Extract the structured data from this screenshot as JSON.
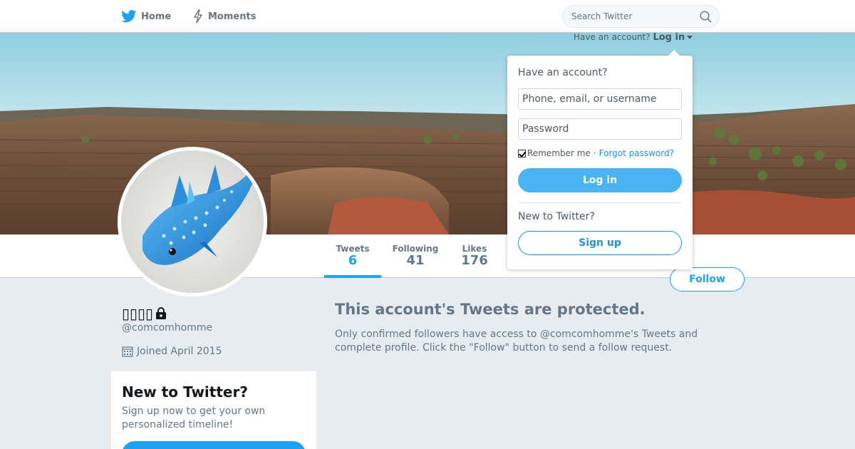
{
  "nav": {
    "home_label": "Home",
    "moments_label": "Moments",
    "search_placeholder": "Search Twitter",
    "icons": {
      "home": "twitter-bird-icon",
      "moments": "lightning-icon",
      "search": "search-icon"
    }
  },
  "login_toggle": {
    "prompt": "Have an account?",
    "action": "Log in"
  },
  "login_dropdown": {
    "heading": "Have an account?",
    "username_placeholder": "Phone, email, or username",
    "password_placeholder": "Password",
    "remember_label": "Remember me",
    "separator": "·",
    "forgot_label": "Forgot password?",
    "login_button": "Log in",
    "new_heading": "New to Twitter?",
    "signup_button": "Sign up"
  },
  "profile_nav": {
    "stats": [
      {
        "label": "Tweets",
        "value": "6"
      },
      {
        "label": "Following",
        "value": "41"
      },
      {
        "label": "Likes",
        "value": "176"
      }
    ],
    "follow_button": "Follow"
  },
  "profile": {
    "name": "▯▯▯▯",
    "handle": "@comcomhomme",
    "joined": "Joined April 2015",
    "icons": {
      "name_suffix": "lock-icon",
      "joined": "calendar-icon"
    }
  },
  "signup_card": {
    "title": "New to Twitter?",
    "body": "Sign up now to get your own personalized timeline!"
  },
  "protected": {
    "title": "This account's Tweets are protected.",
    "body": "Only confirmed followers have access to @comcomhomme's Tweets and complete profile. Click the \"Follow\" button to send a follow request."
  },
  "colors": {
    "accent": "#1da1f2",
    "link": "#1b95e0",
    "muted_text": "#657786",
    "page_bg": "#e6ecf0"
  }
}
